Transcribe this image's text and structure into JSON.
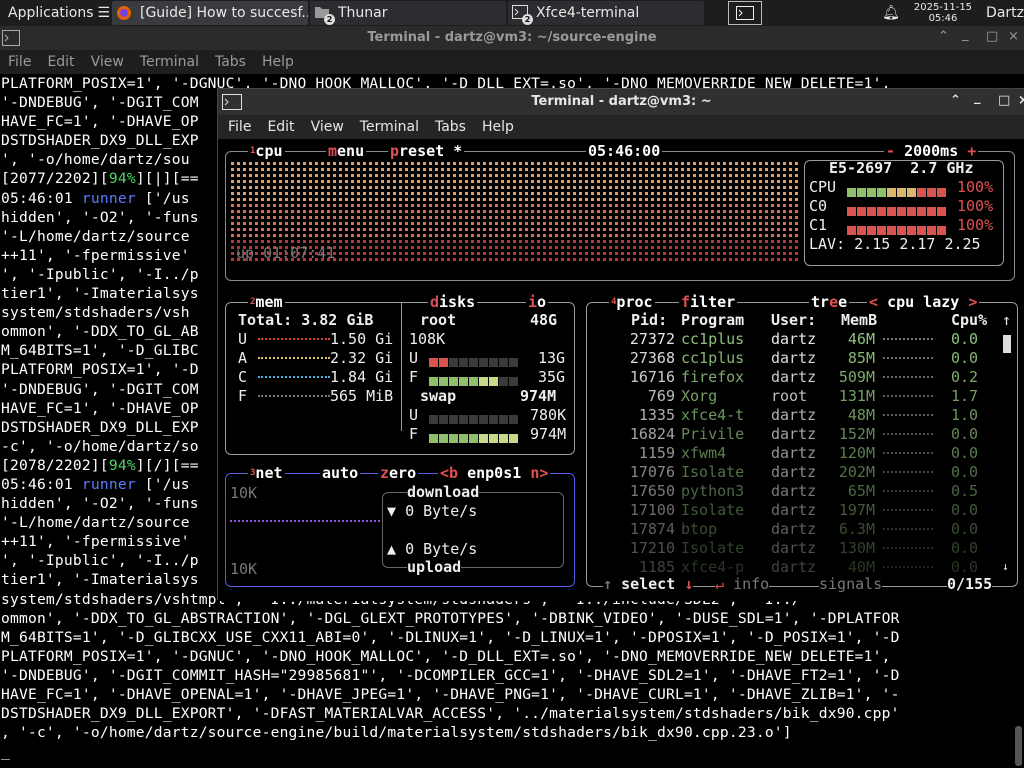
{
  "panel": {
    "apps_label": "Applications",
    "tasks": [
      {
        "label": "[Guide] How to succesf...",
        "icon": "firefox-icon"
      },
      {
        "label": "Thunar",
        "icon": "folder-icon",
        "count": "2"
      },
      {
        "label": "Xfce4-terminal",
        "icon": "terminal-icon",
        "count": "2"
      }
    ],
    "date": "2025-11-15",
    "time": "05:46",
    "user": "Dartz"
  },
  "back_window": {
    "title": "Terminal - dartz@vm3: ~/source-engine",
    "menu": [
      "File",
      "Edit",
      "View",
      "Terminal",
      "Tabs",
      "Help"
    ],
    "lines_left": [
      "PLATFORM_POSIX=1', '-DGNUC', '-DNO_HOOK_MALLOC', '-D_DLL_EXT=.so', '-DNO_MEMOVERRIDE_NEW_DELETE=1',",
      "'-DNDEBUG', '-DGIT_COM",
      "HAVE_FC=1', '-DHAVE_OP",
      "DSTDSHADER_DX9_DLL_EXP",
      "', '-o/home/dartz/sou",
      "[2077/2202][94%][|][==",
      "05:46:01 runner ['/us",
      "hidden', '-O2', '-funs",
      "'-L/home/dartz/source",
      "++11', '-fpermissive'",
      "', '-Ipublic', '-I../p",
      "tier1', '-Imaterialsys",
      "system/stdshaders/vsh",
      "ommon', '-DDX_TO_GL_AB",
      "M_64BITS=1', '-D_GLIBC",
      "PLATFORM_POSIX=1', '-D",
      "'-DNDEBUG', '-DGIT_COM",
      "HAVE_FC=1', '-DHAVE_OP",
      "DSTDSHADER_DX9_DLL_EXP",
      "-c', '-o/home/dartz/so",
      "[2078/2202][94%][/][==",
      "05:46:01 runner ['/us",
      "hidden', '-O2', '-funs",
      "'-L/home/dartz/source",
      "++11', '-fpermissive'",
      "', '-Ipublic', '-I../p",
      "tier1', '-Imaterialsys"
    ],
    "lines_bottom": [
      "system/stdshaders/vshtmpl', '-I../materialsystem/stdshaders', '-I../include/SDL2', '-I../",
      "ommon', '-DDX_TO_GL_ABSTRACTION', '-DGL_GLEXT_PROTOTYPES', '-DBINK_VIDEO', '-DUSE_SDL=1', '-DPLATFOR",
      "M_64BITS=1', '-D_GLIBCXX_USE_CXX11_ABI=0', '-DLINUX=1', '-D_LINUX=1', '-DPOSIX=1', '-D_POSIX=1', '-D",
      "PLATFORM_POSIX=1', '-DGNUC', '-DNO_HOOK_MALLOC', '-D_DLL_EXT=.so', '-DNO_MEMOVERRIDE_NEW_DELETE=1',",
      "'-DNDEBUG', '-DGIT_COMMIT_HASH=\"29985681\"', '-DCOMPILER_GCC=1', '-DHAVE_SDL2=1', '-DHAVE_FT2=1', '-D",
      "HAVE_FC=1', '-DHAVE_OPENAL=1', '-DHAVE_JPEG=1', '-DHAVE_PNG=1', '-DHAVE_CURL=1', '-DHAVE_ZLIB=1', '-",
      "DSTDSHADER_DX9_DLL_EXPORT', '-DFAST_MATERIALVAR_ACCESS', '../materialsystem/stdshaders/bik_dx90.cpp'",
      ", '-c', '-o/home/dartz/source-engine/build/materialsystem/stdshaders/bik_dx90.cpp.23.o']",
      "_"
    ]
  },
  "front_window": {
    "title": "Terminal - dartz@vm3: ~",
    "menu": [
      "File",
      "Edit",
      "View",
      "Terminal",
      "Tabs",
      "Help"
    ]
  },
  "btop": {
    "cpu_box": {
      "num": "1",
      "label": "cpu",
      "menu": "menu",
      "preset": "preset *",
      "clock": "05:46:00",
      "interval": "2000ms",
      "cpu_model": "E5-2697",
      "freq": "2.7 GHz",
      "uptime": "up 01:07:41",
      "meters": [
        {
          "name": "CPU",
          "value": "100%",
          "level": 1.0
        },
        {
          "name": "C0",
          "value": "100%",
          "level": 1.0
        },
        {
          "name": "C1",
          "value": "100%",
          "level": 1.0
        }
      ],
      "lav_label": "LAV:",
      "lav": [
        "2.15",
        "2.17",
        "2.25"
      ]
    },
    "mem_box": {
      "num": "2",
      "label": "mem",
      "total_label": "Total:",
      "total": "3.82 GiB",
      "rows": [
        {
          "k": "U",
          "v": "1.50 Gi"
        },
        {
          "k": "A",
          "v": "2.32 Gi"
        },
        {
          "k": "C",
          "v": "1.84 Gi"
        },
        {
          "k": "F",
          "v": "565 MiB"
        }
      ]
    },
    "disks_box": {
      "label": "disks",
      "io": "io",
      "capacity_label": "108K",
      "root": {
        "name": "root",
        "size": "48G",
        "used": "13G",
        "free": "35G",
        "used_level": 0.27,
        "free_level": 0.73
      },
      "swap": {
        "name": "swap",
        "size": "974M",
        "used": "780K",
        "free": "974M",
        "used_level": 0.0,
        "free_level": 1.0
      }
    },
    "net_box": {
      "num": "3",
      "label": "net",
      "auto": "auto",
      "zero": "zero",
      "b": "<b",
      "iface": "enp0s1",
      "n": "n>",
      "top_scale": "10K",
      "bottom_scale": "10K",
      "download_label": "download",
      "download_rate": "0 Byte/s",
      "upload_label": "upload",
      "upload_rate": "0 Byte/s"
    },
    "proc_box": {
      "num": "4",
      "label": "proc",
      "filter": "filter",
      "tree": "tree",
      "sort": "cpu lazy",
      "headers": [
        "Pid:",
        "Program",
        "User:",
        "MemB",
        "Cpu%"
      ],
      "rows": [
        {
          "pid": "27372",
          "prog": "cc1plus",
          "user": "dartz",
          "mem": "46M",
          "cpu": "0.0"
        },
        {
          "pid": "27368",
          "prog": "cc1plus",
          "user": "dartz",
          "mem": "85M",
          "cpu": "0.0"
        },
        {
          "pid": "16716",
          "prog": "firefox",
          "user": "dartz",
          "mem": "509M",
          "cpu": "0.2"
        },
        {
          "pid": "769",
          "prog": "Xorg",
          "user": "root",
          "mem": "131M",
          "cpu": "1.7"
        },
        {
          "pid": "1335",
          "prog": "xfce4-t",
          "user": "dartz",
          "mem": "48M",
          "cpu": "1.0"
        },
        {
          "pid": "16824",
          "prog": "Privile",
          "user": "dartz",
          "mem": "152M",
          "cpu": "0.0"
        },
        {
          "pid": "1159",
          "prog": "xfwm4",
          "user": "dartz",
          "mem": "120M",
          "cpu": "0.0"
        },
        {
          "pid": "17076",
          "prog": "Isolate",
          "user": "dartz",
          "mem": "202M",
          "cpu": "0.0"
        },
        {
          "pid": "17650",
          "prog": "python3",
          "user": "dartz",
          "mem": "65M",
          "cpu": "0.5"
        },
        {
          "pid": "17100",
          "prog": "Isolate",
          "user": "dartz",
          "mem": "197M",
          "cpu": "0.0"
        },
        {
          "pid": "17874",
          "prog": "btop",
          "user": "dartz",
          "mem": "6.3M",
          "cpu": "0.0"
        },
        {
          "pid": "17210",
          "prog": "Isolate",
          "user": "dartz",
          "mem": "130M",
          "cpu": "0.0"
        },
        {
          "pid": "1185",
          "prog": "xfce4-p",
          "user": "dartz",
          "mem": "40M",
          "cpu": "0.0"
        }
      ],
      "select": "select",
      "info": "info",
      "signals": "signals",
      "count": "0/155"
    }
  }
}
